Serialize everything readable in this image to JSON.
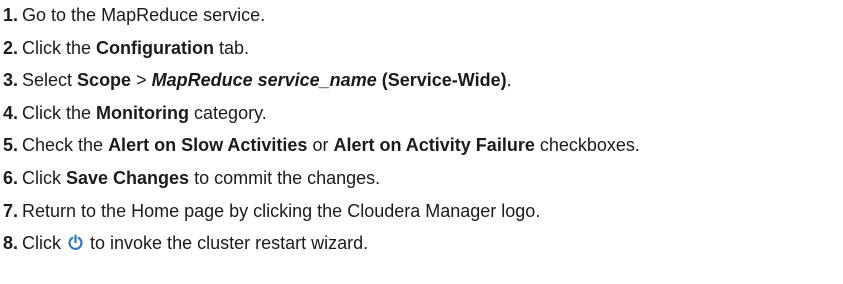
{
  "steps": [
    {
      "number": "1.",
      "text_a": "Go to the MapReduce service."
    },
    {
      "number": "2.",
      "text_a": "Click the ",
      "bold_a": "Configuration",
      "text_b": " tab."
    },
    {
      "number": "3.",
      "text_a": "Select ",
      "bold_a": "Scope",
      "text_b": " > ",
      "bold_italic": "MapReduce service_name",
      "text_c": " ",
      "bold_b": "(Service-Wide)",
      "text_d": "."
    },
    {
      "number": "4.",
      "text_a": "Click the ",
      "bold_a": "Monitoring",
      "text_b": " category."
    },
    {
      "number": "5.",
      "text_a": "Check the ",
      "bold_a": "Alert on Slow Activities",
      "text_b": " or ",
      "bold_b": "Alert on Activity Failure",
      "text_c": " checkboxes."
    },
    {
      "number": "6.",
      "text_a": "Click ",
      "bold_a": "Save Changes",
      "text_b": " to commit the changes."
    },
    {
      "number": "7.",
      "text_a": "Return to the Home page by clicking the Cloudera Manager logo."
    },
    {
      "number": "8.",
      "text_a": "Click ",
      "icon": "power-icon",
      "text_b": " to invoke the cluster restart wizard."
    }
  ],
  "colors": {
    "text": "#1b1b1b",
    "icon": "#2f77c0"
  }
}
